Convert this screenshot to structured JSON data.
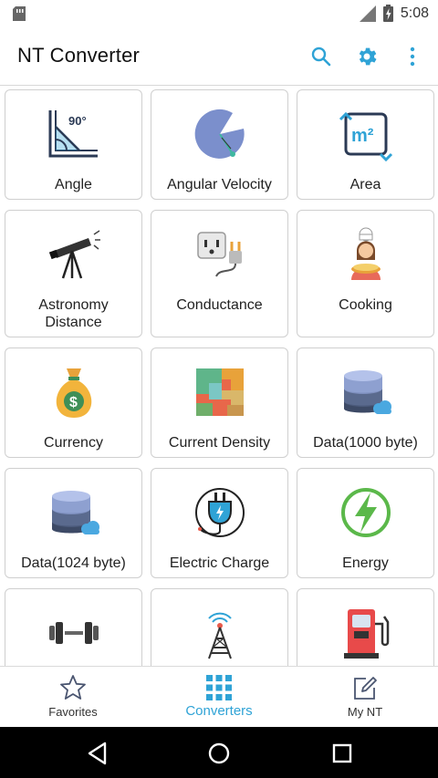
{
  "status_bar": {
    "time": "5:08"
  },
  "app_bar": {
    "title": "NT Converter",
    "actions": [
      "search-icon",
      "gear-icon",
      "more-vert-icon"
    ],
    "accent": "#2fa3d6"
  },
  "converters": [
    {
      "label": "Angle",
      "icon": "angle-icon",
      "badge": "90°"
    },
    {
      "label": "Angular Velocity",
      "icon": "angular-velocity-icon"
    },
    {
      "label": "Area",
      "icon": "area-icon",
      "badge": "m²"
    },
    {
      "label": "Astronomy Distance",
      "icon": "telescope-icon"
    },
    {
      "label": "Conductance",
      "icon": "power-outlet-icon"
    },
    {
      "label": "Cooking",
      "icon": "chef-icon"
    },
    {
      "label": "Currency",
      "icon": "money-bag-icon",
      "badge": "$"
    },
    {
      "label": "Current Density",
      "icon": "map-density-icon"
    },
    {
      "label": "Data(1000 byte)",
      "icon": "database-cloud-icon"
    },
    {
      "label": "Data(1024 byte)",
      "icon": "database-cloud-icon"
    },
    {
      "label": "Electric Charge",
      "icon": "plug-icon"
    },
    {
      "label": "Energy",
      "icon": "lightning-icon"
    },
    {
      "label": "",
      "icon": "dumbbell-icon"
    },
    {
      "label": "",
      "icon": "radio-tower-icon"
    },
    {
      "label": "",
      "icon": "fuel-pump-icon"
    }
  ],
  "bottom_nav": [
    {
      "label": "Favorites",
      "icon": "star-icon",
      "active": false
    },
    {
      "label": "Converters",
      "icon": "grid-icon",
      "active": true
    },
    {
      "label": "My NT",
      "icon": "edit-note-icon",
      "active": false
    }
  ],
  "system_nav": [
    "back-icon",
    "home-icon",
    "recents-icon"
  ]
}
